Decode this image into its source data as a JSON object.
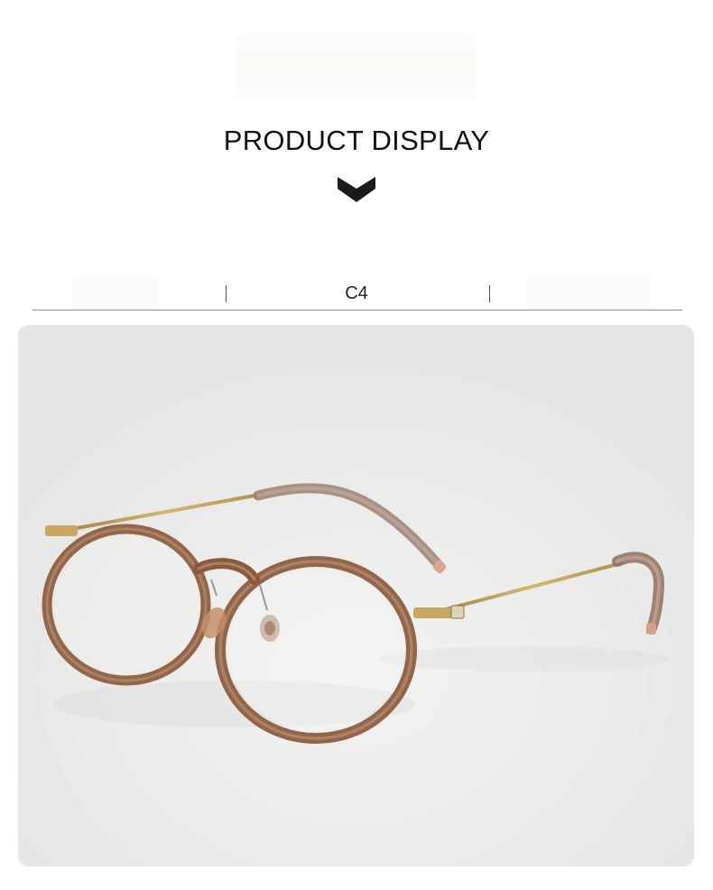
{
  "section": {
    "title": "PRODUCT DISPLAY"
  },
  "tabs": {
    "active_label": "C4"
  },
  "colors": {
    "panel_background": "#ebebea",
    "frame_brown": "#8a5a3c",
    "temple_gold": "#b99650",
    "title_text": "#111111"
  },
  "icons": {
    "chevron": "chevron-down-icon"
  }
}
